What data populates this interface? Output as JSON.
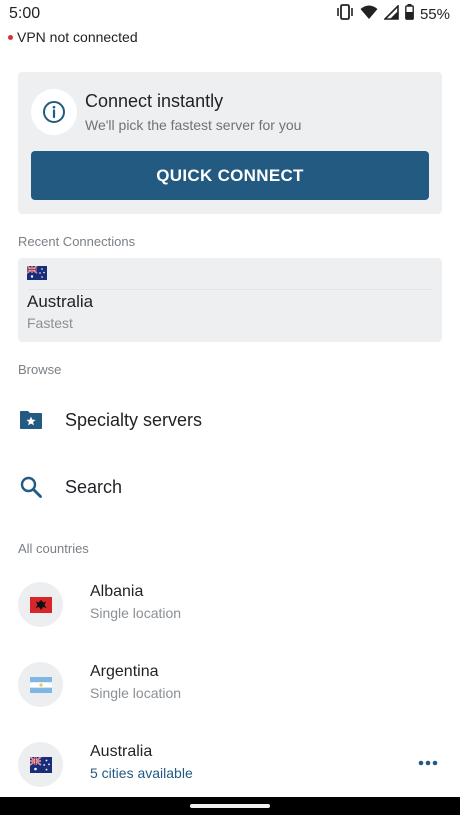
{
  "status_bar": {
    "time": "5:00",
    "battery_percent": "55%",
    "vpn_status": "VPN not connected",
    "icons": [
      "vibrate-icon",
      "wifi-icon",
      "signal-icon",
      "battery-icon"
    ]
  },
  "quick_connect": {
    "title": "Connect instantly",
    "subtitle": "We'll pick the fastest server for you",
    "button_label": "QUICK CONNECT",
    "icon": "info-icon"
  },
  "recent": {
    "section_label": "Recent Connections",
    "items": [
      {
        "country": "Australia",
        "subtitle": "Fastest",
        "flag": "australia-flag"
      }
    ]
  },
  "browse": {
    "section_label": "Browse",
    "items": [
      {
        "label": "Specialty servers",
        "icon": "folder-star-icon"
      },
      {
        "label": "Search",
        "icon": "search-icon"
      }
    ]
  },
  "countries": {
    "section_label": "All countries",
    "items": [
      {
        "name": "Albania",
        "subtitle": "Single location",
        "flag": "albania-flag"
      },
      {
        "name": "Argentina",
        "subtitle": "Single location",
        "flag": "argentina-flag"
      },
      {
        "name": "Australia",
        "subtitle": "5 cities available",
        "flag": "australia-flag",
        "more_icon": "more-horizontal-icon"
      }
    ]
  },
  "colors": {
    "accent": "#235a81",
    "card_bg": "#eeeff1",
    "disconnected_dot": "#d6323a"
  }
}
